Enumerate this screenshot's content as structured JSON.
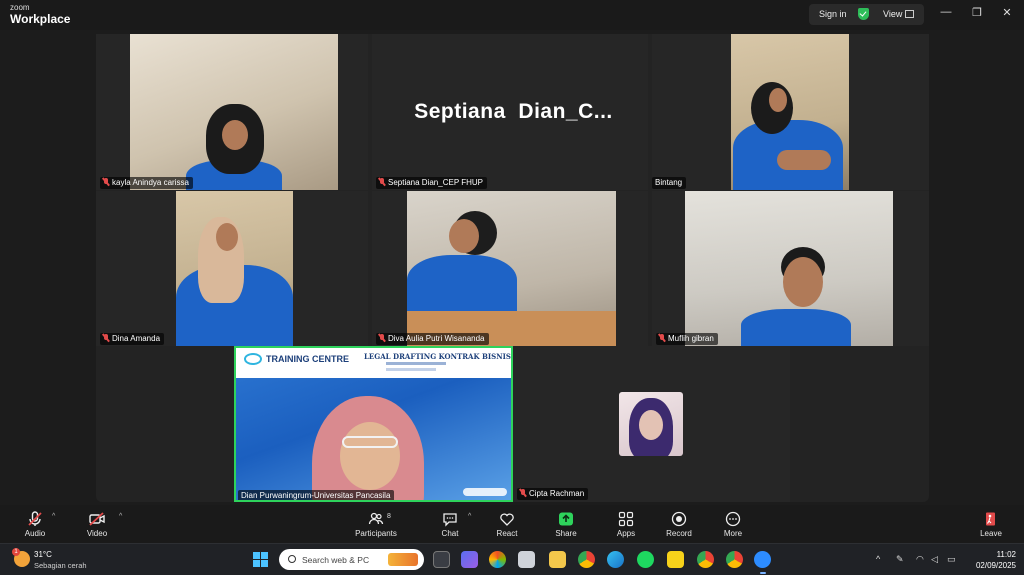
{
  "titlebar": {
    "brand_small": "zoom",
    "brand_large": "Workplace",
    "signin_label": "Sign in",
    "view_label": "View",
    "minimize": "—",
    "restore": "❐",
    "close": "✕"
  },
  "meeting": {
    "big_name": "Septiana  Dian_C...",
    "participants": [
      {
        "name": "kayla Anindya carissa",
        "muted": true
      },
      {
        "name": "Septiana Dian_CEP FHUP",
        "muted": true
      },
      {
        "name": "Bintang",
        "muted": false
      },
      {
        "name": "Dina Amanda",
        "muted": true
      },
      {
        "name": "Diva Aulia Putri Wisananda",
        "muted": true
      },
      {
        "name": "Muflih gibran",
        "muted": true
      },
      {
        "name": "Dian Purwaningrum-Universitas Pancasila",
        "muted": false
      },
      {
        "name": "Cipta Rachman",
        "muted": true
      }
    ],
    "share_content": {
      "banner_title": "TRAINING CENTRE",
      "event_title": "LEGAL DRAFTING KONTRAK BISNIS"
    }
  },
  "toolbar": {
    "audio": "Audio",
    "video": "Video",
    "participants": "Participants",
    "participants_count": "8",
    "chat": "Chat",
    "react": "React",
    "share": "Share",
    "apps": "Apps",
    "record": "Record",
    "more": "More",
    "leave": "Leave"
  },
  "taskbar": {
    "weather_temp": "31°C",
    "weather_condition": "Sebagian cerah",
    "weather_badge": "1",
    "search_placeholder": "Search web & PC",
    "time": "11:02",
    "date": "02/09/2025"
  },
  "colors": {
    "active_speaker_border": "#2ed35c",
    "share_green": "#2ed35c",
    "mute_red": "#e24b4b",
    "shirt_blue": "#1e63c6"
  }
}
